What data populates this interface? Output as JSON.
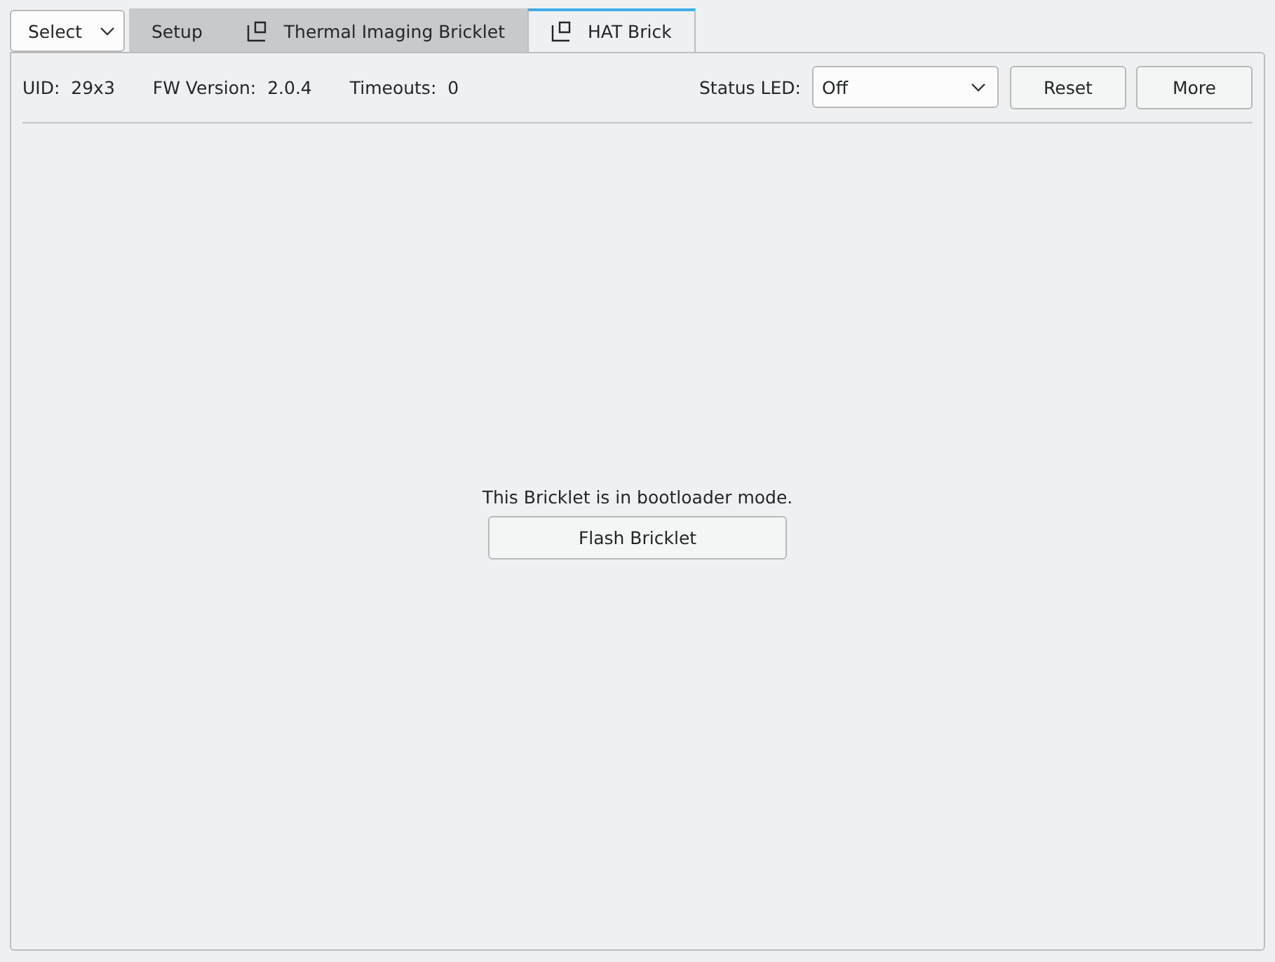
{
  "select": {
    "value": "Select"
  },
  "tabs": [
    {
      "label": "Setup",
      "kind": "plain",
      "selected": false
    },
    {
      "label": "Thermal Imaging Bricklet",
      "kind": "device",
      "selected": false
    },
    {
      "label": "HAT Brick",
      "kind": "device",
      "selected": true
    }
  ],
  "info": [
    {
      "label": "UID:",
      "value": "29x3"
    },
    {
      "label": "FW Version:",
      "value": "2.0.4"
    },
    {
      "label": "Timeouts:",
      "value": "0"
    }
  ],
  "status_led": {
    "label": "Status LED:",
    "value": "Off"
  },
  "buttons": [
    "Reset",
    "More"
  ],
  "message": "This Bricklet is in bootloader mode.",
  "action_button": "Flash Bricklet"
}
